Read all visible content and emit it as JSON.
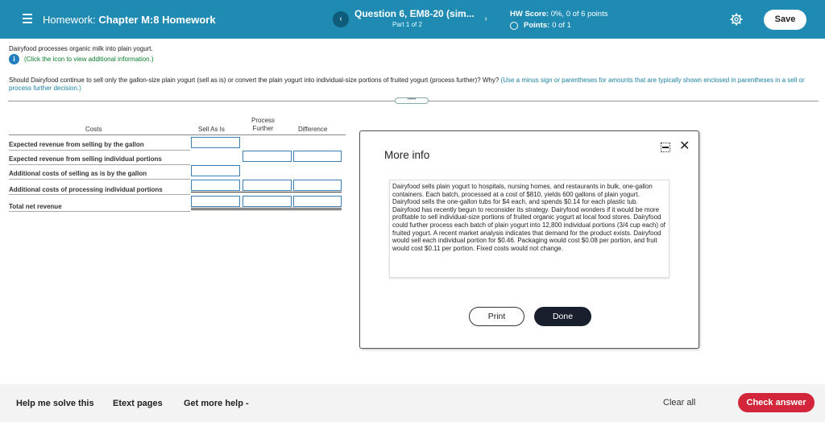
{
  "header": {
    "homework_prefix": "Homework:",
    "homework_name": "Chapter M:8 Homework",
    "question_title": "Question 6, EM8-20 (sim...",
    "question_part": "Part 1 of 2",
    "prev_icon": "chevron-left-icon",
    "next_icon": "chevron-right-icon",
    "hw_score_label": "HW Score:",
    "hw_score_value": "0%, 0 of 6 points",
    "points_label": "Points:",
    "points_value": "0 of 1",
    "save_label": "Save",
    "accent_color": "#1f8bb3"
  },
  "problem": {
    "intro": "Dairyfood processes organic milk into plain yogurt.",
    "info_link": "(Click the icon to view additional information.)",
    "question": "Should Dairyfood continue to sell only the gallon-size plain yogurt (sell as is) or convert the plain yogurt into individual-size portions of fruited yogurt (process further)? Why?",
    "hint": "(Use a minus sign or parentheses for amounts that are typically shown enclosed in parentheses in a sell or process further decision.)"
  },
  "table": {
    "col_costs": "Costs",
    "col_sell": "Sell As Is",
    "col_process_1": "Process",
    "col_process_2": "Further",
    "col_diff": "Difference",
    "rows": [
      "Expected revenue from selling by the gallon",
      "Expected revenue from selling individual portions",
      "Additional costs of selling as is by the gallon",
      "Additional costs of processing individual portions",
      "Total net revenue"
    ]
  },
  "modal": {
    "title": "More info",
    "text": "Dairyfood sells plain yogurt to hospitals, nursing homes, and restaurants in bulk, one-gallon containers. Each batch, processed at a cost of $810, yields 600 gallons of plain yogurt. Dairyfood sells the one-gallon tubs for $4 each, and spends $0.14 for each plastic tub. Dairyfood has recently begun to reconsider its strategy. Dairyfood wonders if it would be more profitable to sell individual-size portions of fruited organic yogurt at local food stores. Dairyfood could further process each batch of plain yogurt into 12,800 individual portions (3/4 cup each) of fruited yogurt. A recent market analysis indicates that demand for the product exists. Dairyfood would sell each individual portion for $0.46. Packaging would cost $0.08 per portion, and fruit would cost $0.11 per portion. Fixed costs would not change.",
    "print_label": "Print",
    "done_label": "Done"
  },
  "footer": {
    "help_label": "Help me solve this",
    "etext_label": "Etext pages",
    "more_help_label": "Get more help -",
    "clear_label": "Clear all",
    "check_label": "Check answer",
    "check_color": "#d3263b"
  }
}
